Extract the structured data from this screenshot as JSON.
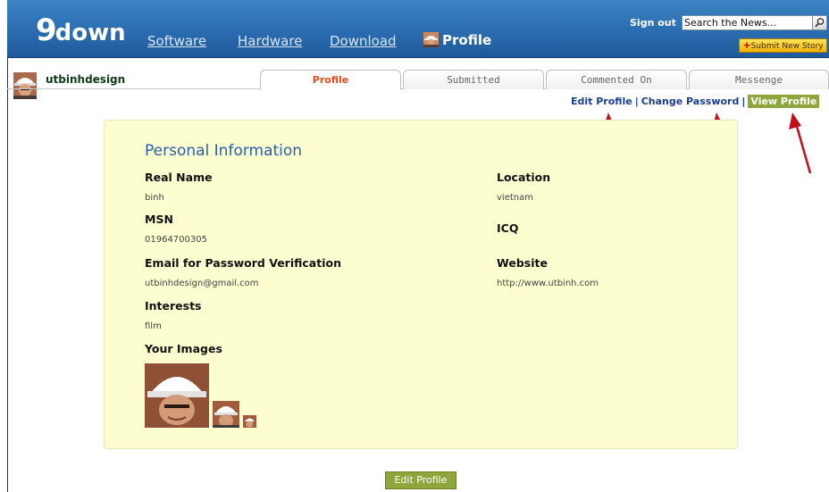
{
  "header": {
    "logo_nine": "9",
    "logo_word": "down",
    "nav": [
      {
        "label": "Software"
      },
      {
        "label": "Hardware"
      },
      {
        "label": "Download"
      }
    ],
    "profile_label": "Profile",
    "signout_label": "Sign out",
    "search_value": "Search the News...",
    "submit_label": "Submit New Story"
  },
  "user": {
    "username": "utbinhdesign"
  },
  "tabs": [
    {
      "label": "Profile",
      "active": true
    },
    {
      "label": "Submitted"
    },
    {
      "label": "Commented On"
    },
    {
      "label": "Messenge"
    }
  ],
  "profile_links": {
    "edit": "Edit Profile",
    "sep": "|",
    "change_password": "Change Password",
    "view": "View Profile"
  },
  "panel": {
    "title": "Personal Information",
    "fields": {
      "real_name_label": "Real Name",
      "real_name_value": "binh",
      "msn_label": "MSN",
      "msn_value": "01964700305",
      "email_label": "Email for Password Verification",
      "email_value": "utbinhdesign@gmail.com",
      "interests_label": "Interests",
      "interests_value": "film",
      "images_label": "Your Images",
      "location_label": "Location",
      "location_value": "vietnam",
      "icq_label": "ICQ",
      "website_label": "Website",
      "website_value": "http://www.utbinh.com"
    }
  },
  "edit_button_label": "Edit Profile",
  "colors": {
    "header_blue": "#2b6cb0",
    "panel_bg": "#fdfed0",
    "title_blue": "#2a5fa8",
    "active_tab_orange": "#e84a1a",
    "view_profile_green": "#8fa63c",
    "arrow_red": "#c0101a"
  }
}
